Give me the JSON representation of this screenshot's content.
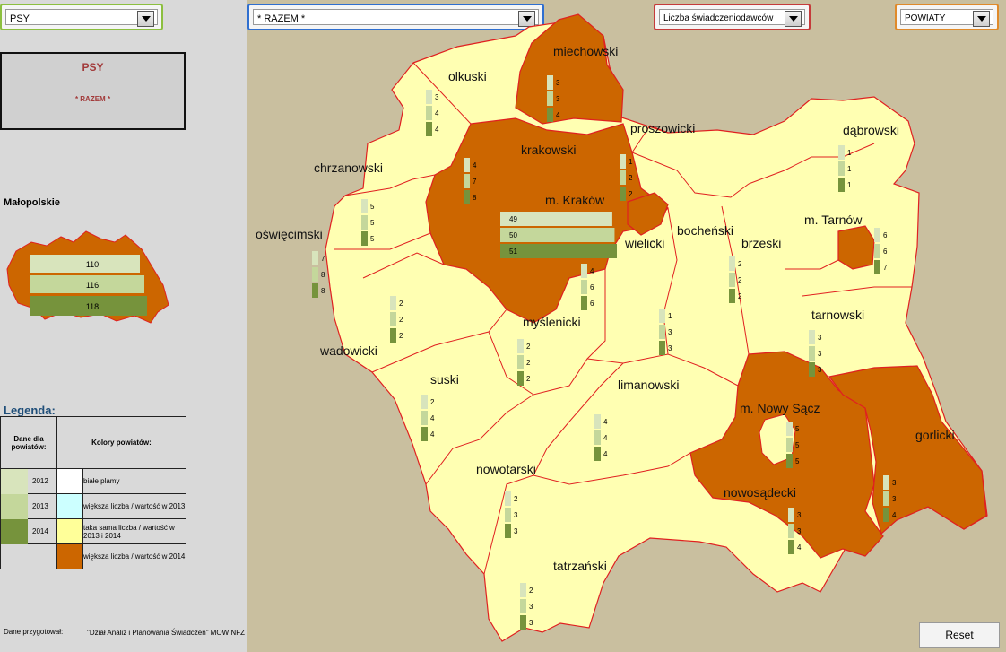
{
  "dropdowns": {
    "category": "PSY",
    "range": "* RAZEM *",
    "measure": "Liczba świadczeniodawców",
    "level": "POWIATY"
  },
  "title_box": {
    "line1": "PSY",
    "line2": "* RAZEM *"
  },
  "region_label": "Małopolskie",
  "region_values": [
    "110",
    "116",
    "118"
  ],
  "legend": {
    "title": "Legenda:",
    "col1": "Dane dla powiatów:",
    "col2": "Kolory powiatów:",
    "years": [
      "2012",
      "2013",
      "2014"
    ],
    "colors": [
      "białe plamy",
      "większa liczba / wartość w 2013",
      "taka sama liczba / wartość w 2013 i 2014",
      "większa liczba / wartość w 2014"
    ]
  },
  "footer": {
    "label": "Dane przygotował:",
    "author": "\"Dział Analiz i Planowania Świadczeń\" MOW NFZ"
  },
  "reset_label": "Reset",
  "colors": {
    "cream": "#ffffb2",
    "orange": "#cc6600",
    "bar2012": "#d8e4bc",
    "bar2013": "#c4d79b",
    "bar2014": "#76933c",
    "border_red": "#e02020"
  },
  "districts": [
    {
      "name": "olkuski",
      "values": [
        "3",
        "4",
        "4"
      ],
      "highlight": false
    },
    {
      "name": "miechowski",
      "values": [
        "3",
        "3",
        "4"
      ],
      "highlight": true
    },
    {
      "name": "proszowicki",
      "values": [
        "1",
        "2",
        "2"
      ],
      "highlight": false
    },
    {
      "name": "dąbrowski",
      "values": [
        "1",
        "1",
        "1"
      ],
      "highlight": false
    },
    {
      "name": "krakowski",
      "values": [
        "4",
        "7",
        "8"
      ],
      "highlight": true
    },
    {
      "name": "chrzanowski",
      "values": [
        "5",
        "5",
        "5"
      ],
      "highlight": false
    },
    {
      "name": "m. Kraków",
      "values": [
        "49",
        "50",
        "51"
      ],
      "highlight": true
    },
    {
      "name": "oświęcimski",
      "values": [
        "7",
        "8",
        "8"
      ],
      "highlight": false
    },
    {
      "name": "wielicki",
      "values": [
        "4",
        "6",
        "6"
      ],
      "highlight": false
    },
    {
      "name": "bocheński",
      "values": [
        "2",
        "2",
        "2"
      ],
      "highlight": false
    },
    {
      "name": "brzeski",
      "values": [
        "1",
        "3",
        "3"
      ],
      "highlight": false
    },
    {
      "name": "m. Tarnów",
      "values": [
        "6",
        "6",
        "7"
      ],
      "highlight": true
    },
    {
      "name": "tarnowski",
      "values": [
        "3",
        "3",
        "3"
      ],
      "highlight": false
    },
    {
      "name": "wadowicki",
      "values": [
        "2",
        "2",
        "2"
      ],
      "highlight": false
    },
    {
      "name": "myślenicki",
      "values": [
        "2",
        "2",
        "2"
      ],
      "highlight": false
    },
    {
      "name": "suski",
      "values": [
        "2",
        "4",
        "4"
      ],
      "highlight": false
    },
    {
      "name": "limanowski",
      "values": [
        "4",
        "4",
        "4"
      ],
      "highlight": false
    },
    {
      "name": "m. Nowy Sącz",
      "values": [
        "5",
        "5",
        "5"
      ],
      "highlight": false
    },
    {
      "name": "gorlicki",
      "values": [
        "3",
        "3",
        "4"
      ],
      "highlight": true
    },
    {
      "name": "nowotarski",
      "values": [
        "2",
        "3",
        "3"
      ],
      "highlight": false
    },
    {
      "name": "nowosądecki",
      "values": [
        "3",
        "3",
        "4"
      ],
      "highlight": true
    },
    {
      "name": "tatrzański",
      "values": [
        "2",
        "3",
        "3"
      ],
      "highlight": false
    }
  ]
}
